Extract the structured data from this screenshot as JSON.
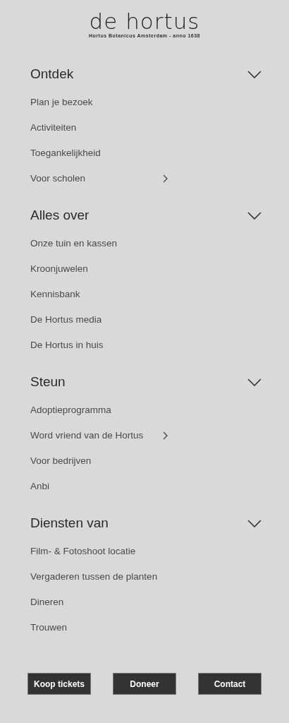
{
  "logo": {
    "name": "de hortus",
    "tagline": "Hortus Botanicus Amsterdam - anno 1638"
  },
  "sections": [
    {
      "title": "Ontdek",
      "expanded": true,
      "items": [
        {
          "label": "Plan je bezoek",
          "has_submenu": false
        },
        {
          "label": "Activiteiten",
          "has_submenu": false
        },
        {
          "label": "Toegankelijkheid",
          "has_submenu": false
        },
        {
          "label": "Voor scholen",
          "has_submenu": true
        }
      ]
    },
    {
      "title": "Alles over",
      "expanded": true,
      "items": [
        {
          "label": "Onze tuin en kassen",
          "has_submenu": false
        },
        {
          "label": "Kroonjuwelen",
          "has_submenu": false
        },
        {
          "label": "Kennisbank",
          "has_submenu": false
        },
        {
          "label": "De Hortus media",
          "has_submenu": false
        },
        {
          "label": "De Hortus in huis",
          "has_submenu": false
        }
      ]
    },
    {
      "title": "Steun",
      "expanded": true,
      "items": [
        {
          "label": "Adoptieprogramma",
          "has_submenu": false
        },
        {
          "label": "Word vriend van de Hortus",
          "has_submenu": true
        },
        {
          "label": "Voor bedrijven",
          "has_submenu": false
        },
        {
          "label": "Anbi",
          "has_submenu": false
        }
      ]
    },
    {
      "title": "Diensten van",
      "expanded": true,
      "items": [
        {
          "label": "Film- & Fotoshoot locatie",
          "has_submenu": false
        },
        {
          "label": "Vergaderen tussen de planten",
          "has_submenu": false
        },
        {
          "label": "Dineren",
          "has_submenu": false
        },
        {
          "label": "Trouwen",
          "has_submenu": false
        }
      ]
    }
  ],
  "buttons": [
    "Koop tickets",
    "Doneer",
    "Contact"
  ]
}
